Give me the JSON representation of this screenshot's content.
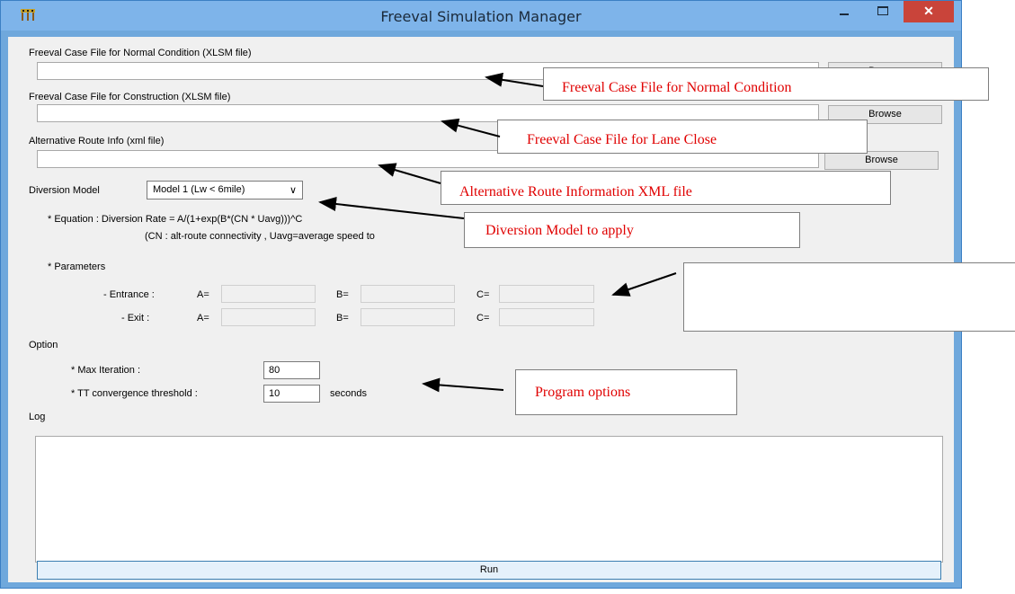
{
  "window": {
    "title": "Freeval Simulation Manager",
    "close_glyph": "✕"
  },
  "normal": {
    "label": "Freeval Case File for Normal Condition (XLSM file)",
    "value": "",
    "browse": "Browse"
  },
  "construction": {
    "label": "Freeval Case File for Construction (XLSM file)",
    "value": "",
    "browse": "Browse"
  },
  "alt_route": {
    "label": "Alternative Route Info (xml file)",
    "value": "",
    "browse": "Browse"
  },
  "diversion": {
    "label": "Diversion Model",
    "selected": "Model 1 (Lw < 6mile)",
    "equation_line1": "* Equation : Diversion Rate = A/(1+exp(B*(CN * Uavg)))^C",
    "equation_line2": "(CN : alt-route connectivity , Uavg=average speed to"
  },
  "parameters": {
    "label": "* Parameters",
    "entrance": {
      "label": "- Entrance :",
      "a": "A=",
      "b": "B=",
      "c": "C="
    },
    "exit": {
      "label": "- Exit :",
      "a": "A=",
      "b": "B=",
      "c": "C="
    }
  },
  "option": {
    "label": "Option",
    "max_iteration_label": "* Max Iteration :",
    "max_iteration_value": "80",
    "tt_label": "* TT convergence threshold :",
    "tt_value": "10",
    "tt_unit": "seconds"
  },
  "log": {
    "label": "Log",
    "content": ""
  },
  "run": {
    "label": "Run"
  },
  "annotations": {
    "normal": "Freeval Case File for Normal Condition",
    "lane_close": "Freeval Case File for Lane Close",
    "alt_route": "Alternative Route Information XML file",
    "diversion": "Diversion Model to apply",
    "parameters": "",
    "options": "Program options"
  },
  "colors": {
    "titlebar": "#7eb4ea",
    "close_button": "#c9443a",
    "annotation_text": "#e00000",
    "run_border": "#3c7fb1"
  },
  "icons": [
    "app-icon",
    "minimize-icon",
    "maximize-icon",
    "close-icon",
    "chevron-down-icon",
    "scroll-up-icon",
    "scroll-down-icon"
  ]
}
